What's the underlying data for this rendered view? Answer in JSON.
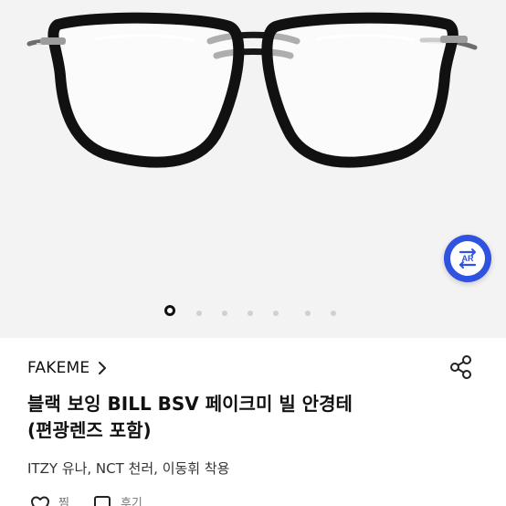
{
  "product": {
    "brand": "FAKEME",
    "title_line1": "블랙 보잉 BILL BSV 페이크미 빌 안경테",
    "title_line2": "(편광렌즈 포함)",
    "subtitle": "ITZY 유나, NCT 천러, 이동휘 착용"
  },
  "gallery": {
    "slide_count": 7,
    "active_slide": 1,
    "ar_label": "AR",
    "image_icon": "eyeglasses-image",
    "ar_icon": "ar-view-icon"
  },
  "actions": {
    "like_label": "찜 ",
    "review_label": "후기 "
  },
  "icons": {
    "brand_chevron": "chevron-right-icon",
    "share": "share-icon",
    "like": "heart-icon",
    "review": "speech-bubble-icon"
  },
  "colors": {
    "ar_button": "#2f52e0",
    "text_primary": "#111111",
    "text_secondary": "#333333",
    "gallery_bg": "#f3f3f3",
    "dot_inactive": "#d0d0d0"
  }
}
